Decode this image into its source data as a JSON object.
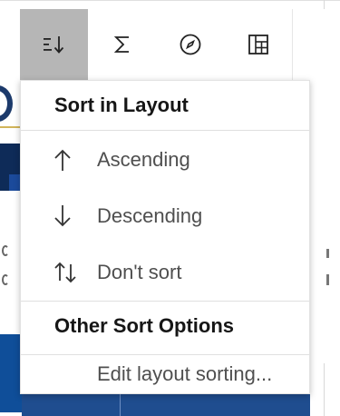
{
  "toolbar": {
    "buttons": [
      {
        "icon": "sort-icon",
        "active": true
      },
      {
        "icon": "sigma-icon",
        "active": false
      },
      {
        "icon": "compass-icon",
        "active": false
      },
      {
        "icon": "table-layout-icon",
        "active": false
      }
    ]
  },
  "menu": {
    "section_sort_title": "Sort in Layout",
    "items": [
      {
        "icon": "arrow-up-icon",
        "label": "Ascending"
      },
      {
        "icon": "arrow-down-icon",
        "label": "Descending"
      },
      {
        "icon": "arrows-up-down-icon",
        "label": "Don't sort"
      }
    ],
    "section_other_title": "Other Sort Options",
    "edit_label": "Edit layout sorting..."
  },
  "colors": {
    "active_button_bg": "#b6b6b6",
    "menu_text": "#4f4f4f",
    "header_text": "#161616",
    "background_blue": "#0e2b58"
  }
}
